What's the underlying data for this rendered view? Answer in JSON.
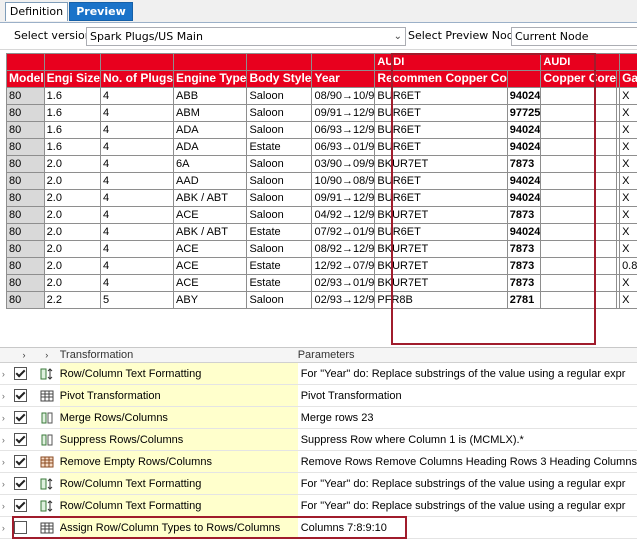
{
  "tabs": [
    "Definition",
    "Preview"
  ],
  "toolbar": {
    "select_version_label": "Select version",
    "version_value": "Spark Plugs/US Main",
    "preview_node_label": "Select Preview Node",
    "preview_node_value": "Current Node"
  },
  "grid": {
    "group_headers": [
      "AUDI",
      "AUDI"
    ],
    "headers": [
      "Model",
      "Engi Size",
      "No. of Plugs",
      "Engine Type",
      "Body Style",
      "Year",
      "Recommen Copper Co",
      "",
      "Copper Core",
      "",
      "Gap"
    ],
    "rows": [
      [
        "80",
        "1.6",
        "4",
        "ABB",
        "Saloon",
        "08/90→10/9",
        "BUR6ET",
        "94024",
        "",
        "",
        "X"
      ],
      [
        "80",
        "1.6",
        "4",
        "ABM",
        "Saloon",
        "09/91→12/9",
        "BUR6ET",
        "97725",
        "",
        "",
        "X"
      ],
      [
        "80",
        "1.6",
        "4",
        "ADA",
        "Saloon",
        "06/93→12/9",
        "BUR6ET",
        "94024",
        "",
        "",
        "X"
      ],
      [
        "80",
        "1.6",
        "4",
        "ADA",
        "Estate",
        "06/93→01/9",
        "BUR6ET",
        "94024",
        "",
        "",
        "X"
      ],
      [
        "80",
        "2.0",
        "4",
        "6A",
        "Saloon",
        "03/90→09/9",
        "BKUR7ET",
        "7873",
        "",
        "",
        "X"
      ],
      [
        "80",
        "2.0",
        "4",
        "AAD",
        "Saloon",
        "10/90→08/9",
        "BUR6ET",
        "94024",
        "",
        "",
        "X"
      ],
      [
        "80",
        "2.0",
        "4",
        "ABK / ABT",
        "Saloon",
        "09/91→12/9",
        "BUR6ET",
        "94024",
        "",
        "",
        "X"
      ],
      [
        "80",
        "2.0",
        "4",
        "ACE",
        "Saloon",
        "04/92→12/9",
        "BKUR7ET",
        "7873",
        "",
        "",
        "X"
      ],
      [
        "80",
        "2.0",
        "4",
        "ABK / ABT",
        "Estate",
        "07/92→01/9",
        "BUR6ET",
        "94024",
        "",
        "",
        "X"
      ],
      [
        "80",
        "2.0",
        "4",
        "ACE",
        "Saloon",
        "08/92→12/9",
        "BKUR7ET",
        "7873",
        "",
        "",
        "X"
      ],
      [
        "80",
        "2.0",
        "4",
        "ACE",
        "Estate",
        "12/92→07/9",
        "BKUR7ET",
        "7873",
        "",
        "",
        "0.8"
      ],
      [
        "80",
        "2.0",
        "4",
        "ACE",
        "Estate",
        "02/93→01/9",
        "BKUR7ET",
        "7873",
        "",
        "",
        "X"
      ],
      [
        "80",
        "2.2",
        "5",
        "ABY",
        "Saloon",
        "02/93→12/9",
        "PFR8B",
        "2781",
        "",
        "",
        "X"
      ]
    ]
  },
  "transformations": {
    "col_transformation": "Transformation",
    "col_parameters": "Parameters",
    "items": [
      {
        "name": "Row/Column Text Formatting",
        "params": "For \"Year\" do: Replace substrings of the value using a regular expr",
        "checked": true,
        "icon": "text-format-icon"
      },
      {
        "name": "Pivot Transformation",
        "params": "Pivot Transformation",
        "checked": true,
        "icon": "table-icon"
      },
      {
        "name": "Merge Rows/Columns",
        "params": "Merge rows 23",
        "checked": true,
        "icon": "column-icon"
      },
      {
        "name": "Suppress Rows/Columns",
        "params": "Suppress Row where Column 1 is (MCMLX).*",
        "checked": true,
        "icon": "column-icon"
      },
      {
        "name": "Remove Empty Rows/Columns",
        "params": "Remove Rows Remove Columns Heading Rows 3 Heading Columns",
        "checked": true,
        "icon": "grid-icon"
      },
      {
        "name": "Row/Column Text Formatting",
        "params": "For \"Year\" do: Replace substrings of the value using a regular expr",
        "checked": true,
        "icon": "text-format-icon"
      },
      {
        "name": "Row/Column Text Formatting",
        "params": "For \"Year\" do: Replace substrings of the value using a regular expr",
        "checked": true,
        "icon": "text-format-icon"
      },
      {
        "name": "Assign Row/Column Types to Rows/Columns",
        "params": "Columns 7:8:9:10",
        "checked": false,
        "icon": "table-icon"
      }
    ]
  },
  "colors": {
    "header_red": "#e8001e",
    "highlight_border": "#a01c2c",
    "tab_blue": "#1a73c9",
    "yellow": "#ffffcc"
  }
}
